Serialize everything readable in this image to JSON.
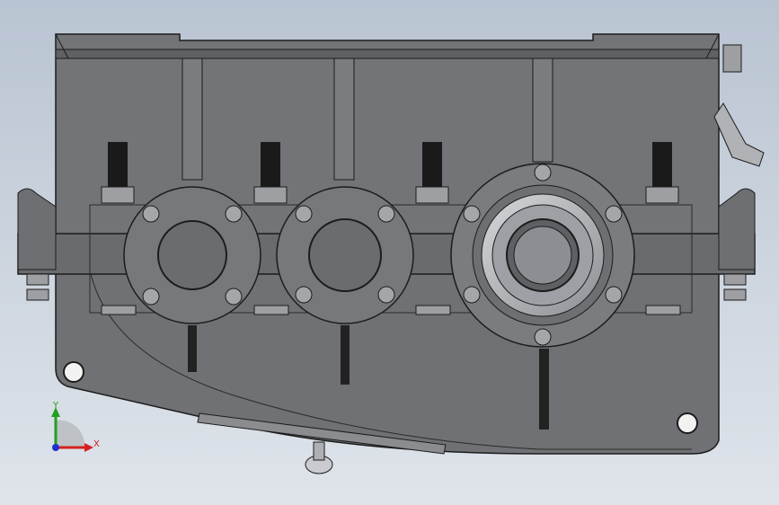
{
  "viewport": {
    "background_top": "#b9c4d2",
    "background_bottom": "#dfe4ea"
  },
  "model": {
    "housing_color": "#6f7174",
    "housing_edge": "#1c1c1c",
    "bolt_color": "#1a1a1a",
    "nut_color": "#9d9fa2",
    "flange_color": "#76787b",
    "bearing_color": "#b5b8bc"
  },
  "triad": {
    "x_label": "X",
    "y_label": "Y",
    "x_color": "#d62020",
    "y_color": "#20a020",
    "z_color": "#2030d0"
  }
}
